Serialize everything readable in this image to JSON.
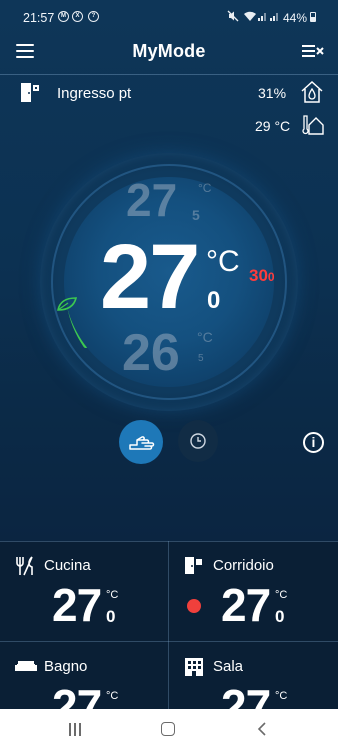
{
  "status_bar": {
    "time": "21:57",
    "notifications": [
      "M",
      "X",
      "?"
    ],
    "battery": "44%"
  },
  "header": {
    "title": "MyMode",
    "menu_icon": "hamburger-menu-icon",
    "right_icon": "mode-list-icon"
  },
  "zone": {
    "name": "Ingresso pt",
    "humidity": "31%",
    "outdoor_temp": "29 °C"
  },
  "dial": {
    "upper_temp": "27",
    "upper_unit": "°C",
    "upper_decimal": "5",
    "current_temp": "27",
    "current_unit": "°C",
    "current_decimal": "0",
    "setpoint": "30",
    "setpoint_decimal": "0",
    "lower_temp": "26",
    "lower_unit": "°C",
    "lower_decimal": "5"
  },
  "controls": {
    "manual_mode": "hand-icon",
    "schedule_mode": "clock-icon",
    "info": "i"
  },
  "zones": [
    {
      "name": "Cucina",
      "temp": "27",
      "unit": "°C",
      "decimal": "0",
      "icon": "fork-knife-icon",
      "alert": false
    },
    {
      "name": "Corridoio",
      "temp": "27",
      "unit": "°C",
      "decimal": "0",
      "icon": "door-icon",
      "alert": true
    },
    {
      "name": "Bagno",
      "temp": "27",
      "unit": "°C",
      "decimal": "",
      "icon": "sofa-icon",
      "alert": false
    },
    {
      "name": "Sala",
      "temp": "27",
      "unit": "°C",
      "decimal": "",
      "icon": "building-icon",
      "alert": false
    }
  ],
  "colors": {
    "accent_blue": "#1e78b8",
    "alert_red": "#f0403c",
    "setpoint_red": "#ff3c3c",
    "eco_green": "#3cc850"
  }
}
